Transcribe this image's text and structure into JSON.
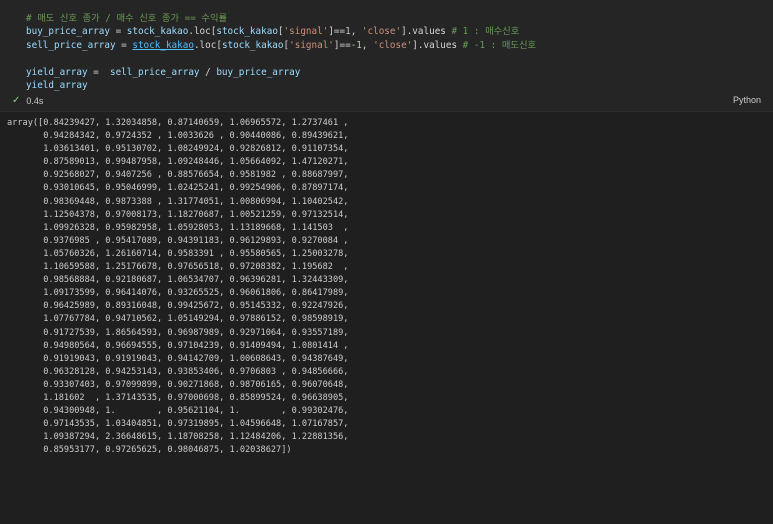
{
  "cell": {
    "code_lines": [
      {
        "tokens": [
          {
            "t": "# 매도 신호 종가 / 매수 신호 종가 == 수익률",
            "c": "cm"
          }
        ]
      },
      {
        "tokens": [
          {
            "t": "buy_price_array",
            "c": "var"
          },
          {
            "t": " = ",
            "c": "op"
          },
          {
            "t": "stock_kakao",
            "c": "var"
          },
          {
            "t": ".loc[",
            "c": "op"
          },
          {
            "t": "stock_kakao",
            "c": "var"
          },
          {
            "t": "[",
            "c": "op"
          },
          {
            "t": "'signal'",
            "c": "str"
          },
          {
            "t": "]==",
            "c": "op"
          },
          {
            "t": "1",
            "c": "num"
          },
          {
            "t": ", ",
            "c": "op"
          },
          {
            "t": "'close'",
            "c": "str"
          },
          {
            "t": "].values ",
            "c": "op"
          },
          {
            "t": "# 1 : 매수신호",
            "c": "cm"
          }
        ]
      },
      {
        "tokens": [
          {
            "t": "sell_price_array",
            "c": "var"
          },
          {
            "t": " = ",
            "c": "op"
          },
          {
            "t": "stock_kakao",
            "c": "link"
          },
          {
            "t": ".loc[",
            "c": "op"
          },
          {
            "t": "stock_kakao",
            "c": "var"
          },
          {
            "t": "[",
            "c": "op"
          },
          {
            "t": "'signal'",
            "c": "str"
          },
          {
            "t": "]==",
            "c": "op"
          },
          {
            "t": "-1",
            "c": "num"
          },
          {
            "t": ", ",
            "c": "op"
          },
          {
            "t": "'close'",
            "c": "str"
          },
          {
            "t": "].values ",
            "c": "op"
          },
          {
            "t": "# -1 : 매도신호",
            "c": "cm"
          }
        ]
      },
      {
        "tokens": [
          {
            "t": " ",
            "c": "op"
          }
        ]
      },
      {
        "tokens": [
          {
            "t": "yield_array",
            "c": "var"
          },
          {
            "t": " =  ",
            "c": "op"
          },
          {
            "t": "sell_price_array",
            "c": "var"
          },
          {
            "t": " / ",
            "c": "op"
          },
          {
            "t": "buy_price_array",
            "c": "var"
          }
        ]
      },
      {
        "tokens": [
          {
            "t": "yield_array",
            "c": "var"
          }
        ]
      }
    ],
    "status": {
      "check_icon": "check-icon",
      "time": "0.4s"
    },
    "language": "Python"
  },
  "output_lines": [
    "array([0.84239427, 1.32034858, 0.87140659, 1.06965572, 1.2737461 ,",
    "       0.94284342, 0.9724352 , 1.0033626 , 0.90440086, 0.89439621,",
    "       1.03613401, 0.95130702, 1.08249924, 0.92826812, 0.91107354,",
    "       0.87589013, 0.99487958, 1.09248446, 1.05664092, 1.47120271,",
    "       0.92568027, 0.9407256 , 0.88576654, 0.9581982 , 0.88687997,",
    "       0.93010645, 0.95046999, 1.02425241, 0.99254906, 0.87897174,",
    "       0.98369448, 0.9873388 , 1.31774051, 1.00806994, 1.10402542,",
    "       1.12504378, 0.97008173, 1.18270687, 1.00521259, 0.97132514,",
    "       1.09926328, 0.95982958, 1.05928053, 1.13189668, 1.141503  ,",
    "       0.9376985 , 0.95417089, 0.94391183, 0.96129893, 0.9270084 ,",
    "       1.05760326, 1.26160714, 0.9583391 , 0.95580565, 1.25003278,",
    "       1.10659588, 1.25176678, 0.97656518, 0.97208382, 1.195682  ,",
    "       0.98568884, 0.92180687, 1.06534707, 0.96396281, 1.32443309,",
    "       1.09173599, 0.96414076, 0.93265525, 0.96061806, 0.86417989,",
    "       0.96425989, 0.89316048, 0.99425672, 0.95145332, 0.92247926,",
    "       1.07767784, 0.94710562, 1.05149294, 0.97886152, 0.98598919,",
    "       0.91727539, 1.86564593, 0.96987989, 0.92971064, 0.93557189,",
    "       0.94980564, 0.96694555, 0.97104239, 0.91409494, 1.0801414 ,",
    "       0.91919043, 0.91919043, 0.94142709, 1.00608643, 0.94387649,",
    "       0.96328128, 0.94253143, 0.93853406, 0.9706803 , 0.94856666,",
    "       0.93307403, 0.97099899, 0.90271868, 0.98706165, 0.96070648,",
    "       1.181602  , 1.37143535, 0.97000698, 0.85899524, 0.96638905,",
    "       0.94300948, 1.        , 0.95621104, 1.        , 0.99302476,",
    "       0.97143535, 1.03404851, 0.97319895, 1.04596648, 1.07167857,",
    "       1.09387294, 2.36648615, 1.18708258, 1.12484206, 1.22881356,",
    "       0.85953177, 0.97265625, 0.98046875, 1.02038627])"
  ]
}
